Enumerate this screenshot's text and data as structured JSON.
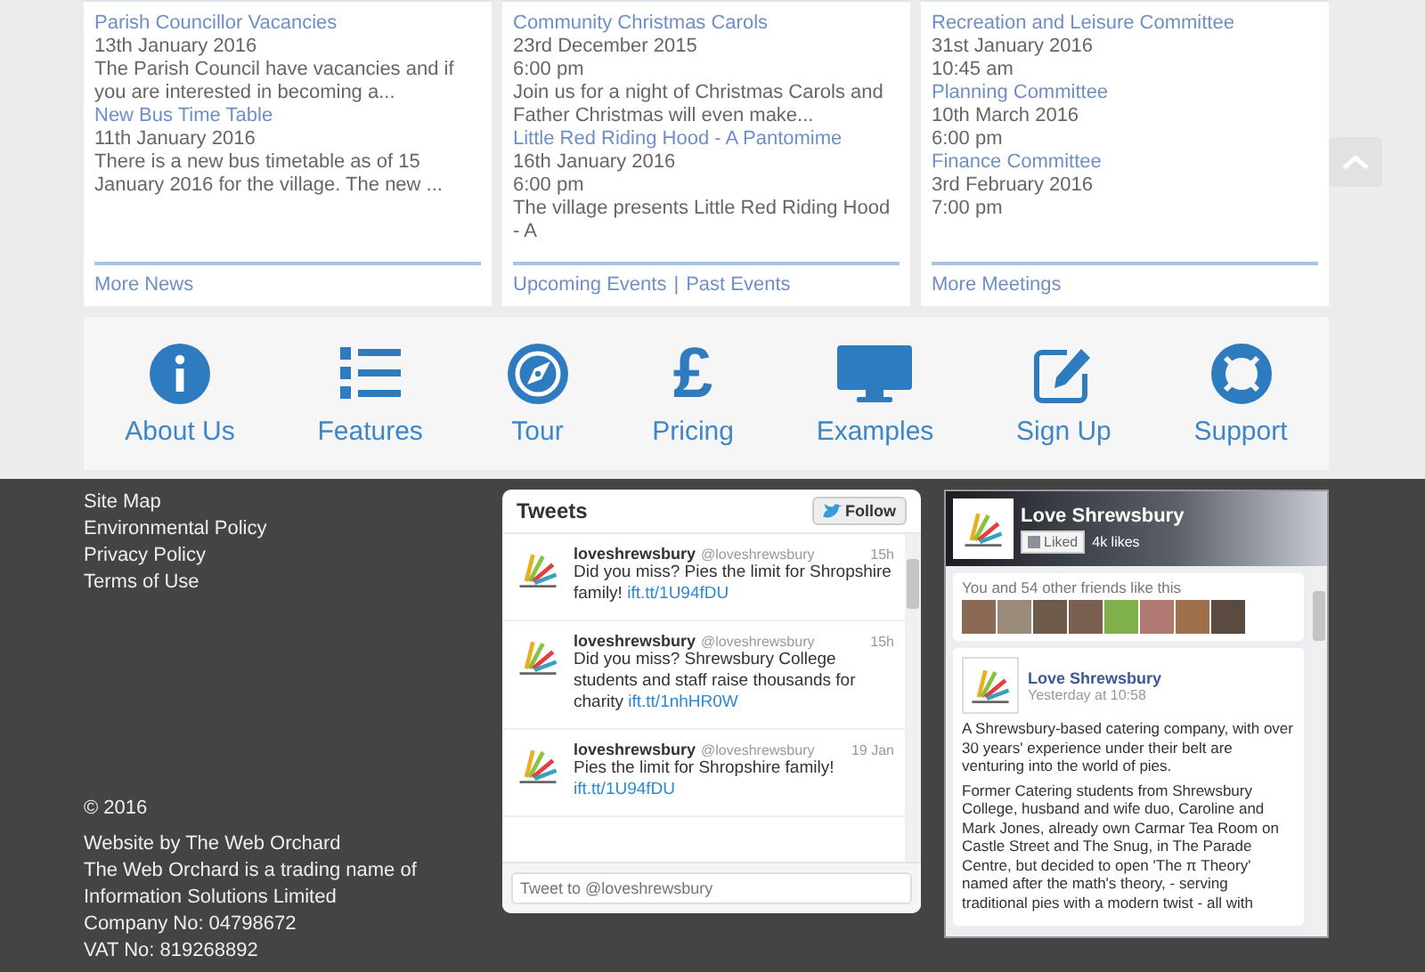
{
  "cards": [
    {
      "items": [
        {
          "title": "Parish Councillor Vacancies",
          "date": "13th January 2016",
          "excerpt": "The Parish Council have vacancies and if you are interested in becoming a..."
        },
        {
          "title": "New Bus Time Table",
          "date": "11th January 2016",
          "excerpt": "There is a new bus timetable as of 15 January 2016 for the village. The new ..."
        }
      ],
      "links": [
        "More News"
      ]
    },
    {
      "items": [
        {
          "title": "Community Christmas Carols",
          "date": "23rd December 2015",
          "time": "6:00 pm",
          "excerpt": "Join us for a night of Christmas Carols and Father Christmas will even make..."
        },
        {
          "title": "Little Red Riding Hood - A Pantomime",
          "date": "16th January 2016",
          "time": "6:00 pm",
          "excerpt": "The village presents Little Red Riding Hood - A"
        }
      ],
      "links": [
        "Upcoming Events",
        "Past Events"
      ],
      "separator": "|"
    },
    {
      "items": [
        {
          "title": "Recreation and Leisure Committee",
          "date": "31st January 2016",
          "time": "10:45 am"
        },
        {
          "title": "Planning Committee",
          "date": "10th March 2016",
          "time": "6:00 pm"
        },
        {
          "title": "Finance Committee",
          "date": "3rd February 2016",
          "time": "7:00 pm"
        }
      ],
      "links": [
        "More Meetings"
      ]
    }
  ],
  "nav_tiles": [
    {
      "label": "About Us",
      "kind": "info"
    },
    {
      "label": "Features",
      "kind": "list"
    },
    {
      "label": "Tour",
      "kind": "compass"
    },
    {
      "label": "Pricing",
      "kind": "glyph",
      "glyph": "£"
    },
    {
      "label": "Examples",
      "kind": "monitor"
    },
    {
      "label": "Sign Up",
      "kind": "edit"
    },
    {
      "label": "Support",
      "kind": "lifebuoy"
    }
  ],
  "footer": {
    "links": [
      "Site Map",
      "Environmental Policy",
      "Privacy Policy",
      "Terms of Use"
    ],
    "copyright": "© 2016",
    "credit": "Website by The Web Orchard",
    "company_lines": [
      "The Web Orchard is a trading name of",
      "Information Solutions Limited",
      "Company No: 04798672",
      "VAT No: 819268892"
    ]
  },
  "twitter": {
    "title": "Tweets",
    "follow_label": "Follow",
    "tweets": [
      {
        "name": "loveshrewsbury",
        "handle": "@loveshrewsbury",
        "time": "15h",
        "text": "Did you miss? Pies the limit for Shropshire family!",
        "link": "ift.tt/1U94fDU"
      },
      {
        "name": "loveshrewsbury",
        "handle": "@loveshrewsbury",
        "time": "15h",
        "text": "Did you miss? Shrewsbury College students and staff raise thousands for charity",
        "link": "ift.tt/1nhHR0W"
      },
      {
        "name": "loveshrewsbury",
        "handle": "@loveshrewsbury",
        "time": "19 Jan",
        "text": "Pies the limit for Shropshire family!",
        "link": "ift.tt/1U94fDU"
      }
    ],
    "placeholder": "Tweet to @loveshrewsbury"
  },
  "facebook": {
    "page_name": "Love Shrewsbury",
    "liked_label": "Liked",
    "likes": "4k likes",
    "friends_text": "You and 54 other friends like this",
    "post": {
      "author": "Love Shrewsbury",
      "time": "Yesterday at 10:58",
      "paragraphs": [
        "A Shrewsbury-based catering company, with over 30 years' experience under their belt are venturing into the world of pies.",
        "Former Catering students from Shrewsbury College, husband and wife duo, Caroline and Mark Jones, already own Carmar Tea Room on Castle Street and The Snug, in The Parade Centre, but decided to open 'The π Theory' named after the math's theory, - serving traditional pies with a modern twist - all with"
      ]
    }
  }
}
